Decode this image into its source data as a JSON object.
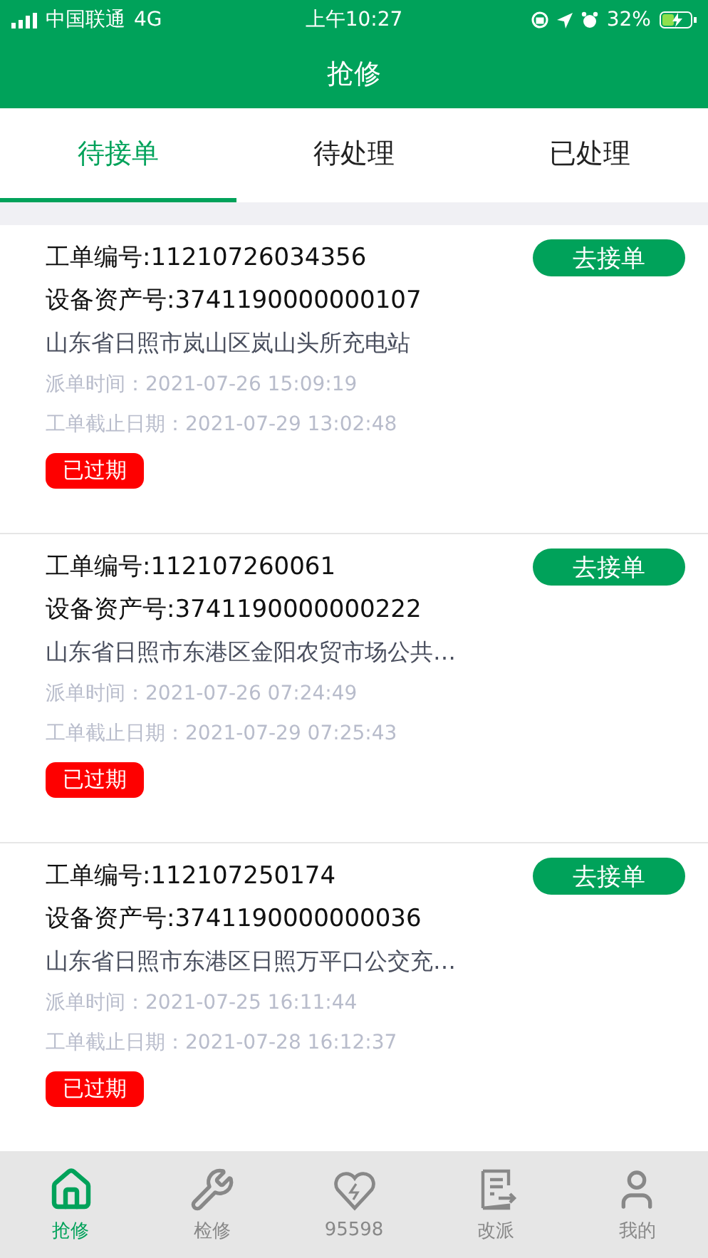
{
  "status_bar": {
    "carrier": "中国联通",
    "network": "4G",
    "time": "上午10:27",
    "battery": "32%"
  },
  "header": {
    "title": "抢修"
  },
  "tabs": [
    {
      "label": "待接单",
      "selected": true
    },
    {
      "label": "待处理",
      "selected": false
    },
    {
      "label": "已处理",
      "selected": false
    }
  ],
  "orders": [
    {
      "order_no": "工单编号:11210726034356",
      "asset_no": "设备资产号:3741190000000107",
      "address": "山东省日照市岚山区岚山头所充电站",
      "dispatch_time": "派单时间：2021-07-26 15:09:19",
      "deadline": "工单截止日期：2021-07-29 13:02:48",
      "action": "去接单",
      "status": "已过期"
    },
    {
      "order_no": "工单编号:112107260061",
      "asset_no": "设备资产号:3741190000000222",
      "address": "山东省日照市东港区金阳农贸市场公共…",
      "dispatch_time": "派单时间：2021-07-26 07:24:49",
      "deadline": "工单截止日期：2021-07-29 07:25:43",
      "action": "去接单",
      "status": "已过期"
    },
    {
      "order_no": "工单编号:112107250174",
      "asset_no": "设备资产号:3741190000000036",
      "address": "山东省日照市东港区日照万平口公交充…",
      "dispatch_time": "派单时间：2021-07-25 16:11:44",
      "deadline": "工单截止日期：2021-07-28 16:12:37",
      "action": "去接单",
      "status": "已过期"
    }
  ],
  "bottom_nav": [
    {
      "label": "抢修",
      "kind": "home",
      "selected": true
    },
    {
      "label": "检修",
      "kind": "wrench",
      "selected": false
    },
    {
      "label": "95598",
      "kind": "heart",
      "selected": false
    },
    {
      "label": "改派",
      "kind": "form",
      "selected": false
    },
    {
      "label": "我的",
      "kind": "user",
      "selected": false
    }
  ]
}
